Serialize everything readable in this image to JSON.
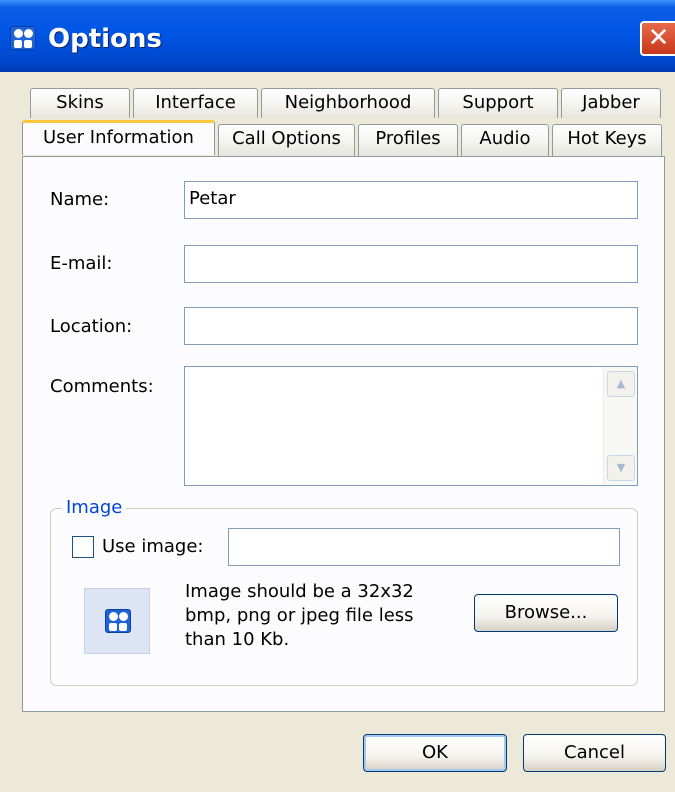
{
  "window": {
    "title": "Options",
    "close_label": "✕"
  },
  "tabs": {
    "row1": [
      "Skins",
      "Interface",
      "Neighborhood",
      "Support",
      "Jabber"
    ],
    "row2": [
      "User Information",
      "Call Options",
      "Profiles",
      "Audio",
      "Hot Keys"
    ],
    "active": "User Information"
  },
  "form": {
    "name_label": "Name:",
    "name_value": "Petar",
    "email_label": "E-mail:",
    "email_value": "",
    "location_label": "Location:",
    "location_value": "",
    "comments_label": "Comments:",
    "comments_value": ""
  },
  "image_group": {
    "title": "Image",
    "use_image_label": "Use image:",
    "use_image_checked": false,
    "path_value": "",
    "note": "Image should be a 32x32 bmp, png or jpeg file less than 10 Kb.",
    "browse_label": "Browse..."
  },
  "footer": {
    "ok_label": "OK",
    "cancel_label": "Cancel"
  },
  "icons": {
    "app": "app-icon",
    "close": "close-icon",
    "scroll_up": "scroll-up-icon",
    "scroll_down": "scroll-down-icon"
  }
}
